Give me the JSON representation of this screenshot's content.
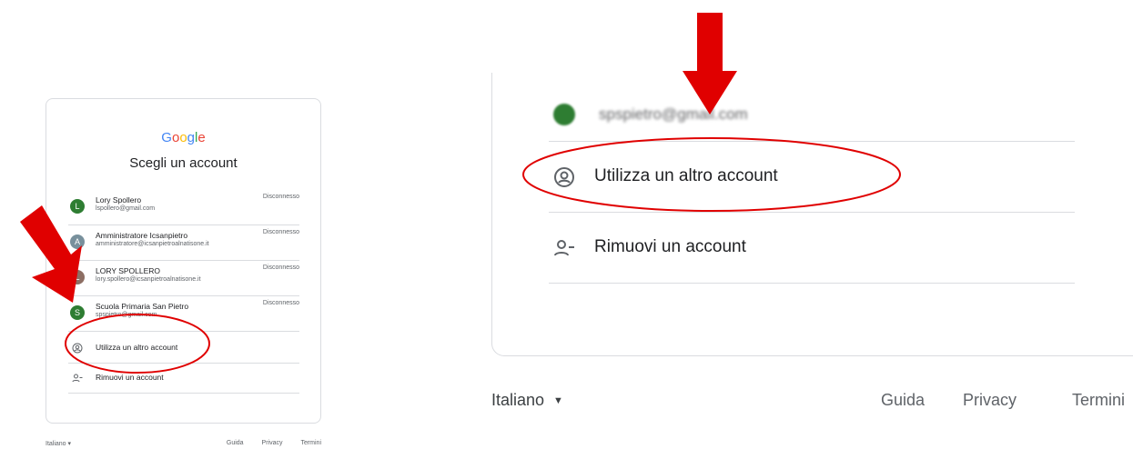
{
  "small": {
    "logo": "Google",
    "heading": "Scegli un account",
    "accounts": [
      {
        "initial": "L",
        "name": "Lory Spollero",
        "email": "lspollero@gmail.com",
        "status": "Disconnesso",
        "color": "#2e7d32"
      },
      {
        "initial": "A",
        "name": "Amministratore Icsanpietro",
        "email": "amministratore@icsanpietroalnatisone.it",
        "status": "Disconnesso",
        "color": "#78909c"
      },
      {
        "initial": "L",
        "name": "LORY SPOLLERO",
        "email": "lory.spollero@icsanpietroalnatisone.it",
        "status": "Disconnesso",
        "color": "#8d6e63"
      },
      {
        "initial": "S",
        "name": "Scuola Primaria San Pietro",
        "email": "spspietro@gmail.com",
        "status": "Disconnesso",
        "color": "#2e7d32"
      }
    ],
    "use_other": "Utilizza un altro account",
    "remove": "Rimuovi un account",
    "footer": {
      "language": "Italiano",
      "help": "Guida",
      "privacy": "Privacy",
      "terms": "Termini"
    }
  },
  "large": {
    "partial_email": "spspietro@gmail.com",
    "use_other": "Utilizza un altro account",
    "remove": "Rimuovi un account",
    "footer": {
      "language": "Italiano",
      "help": "Guida",
      "privacy": "Privacy",
      "terms": "Termini"
    }
  },
  "colors": {
    "arrow": "#e00000",
    "ellipse": "#e00000",
    "border": "#dadce0"
  }
}
